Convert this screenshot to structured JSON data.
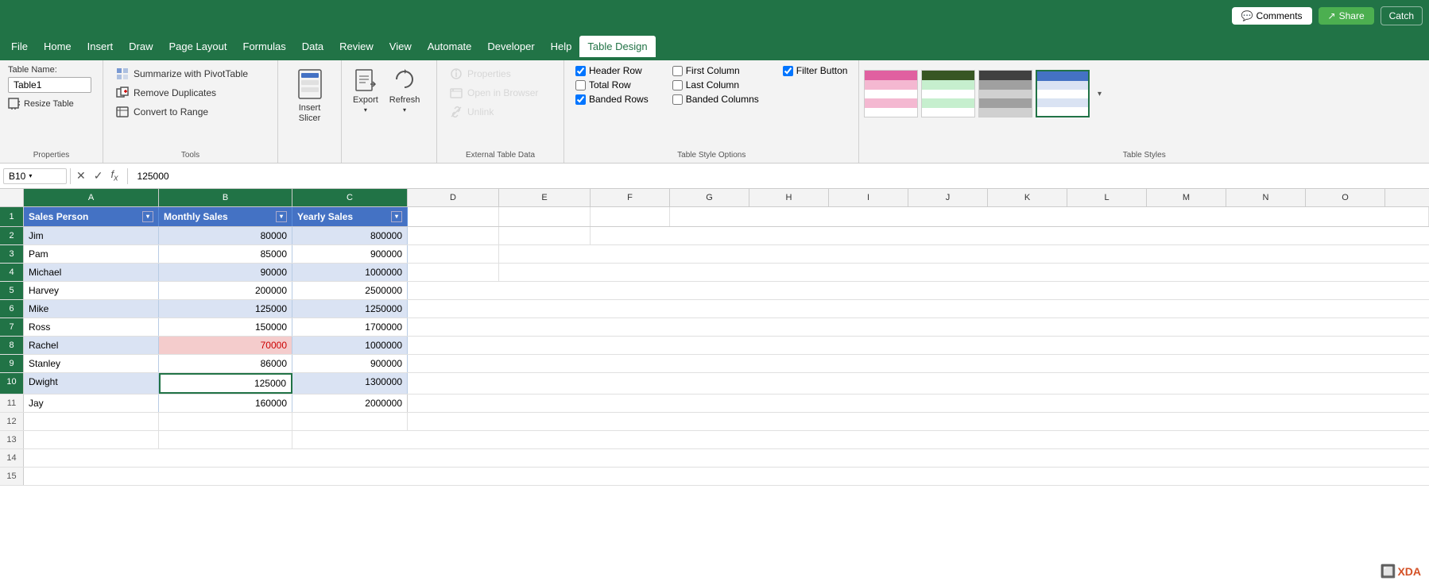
{
  "titlebar": {
    "comments_label": "Comments",
    "share_label": "Share",
    "catch_label": "Catch"
  },
  "menubar": {
    "items": [
      {
        "label": "File",
        "active": false
      },
      {
        "label": "Home",
        "active": false
      },
      {
        "label": "Insert",
        "active": false
      },
      {
        "label": "Draw",
        "active": false
      },
      {
        "label": "Page Layout",
        "active": false
      },
      {
        "label": "Formulas",
        "active": false
      },
      {
        "label": "Data",
        "active": false
      },
      {
        "label": "Review",
        "active": false
      },
      {
        "label": "View",
        "active": false
      },
      {
        "label": "Automate",
        "active": false
      },
      {
        "label": "Developer",
        "active": false
      },
      {
        "label": "Help",
        "active": false
      },
      {
        "label": "Table Design",
        "active": true
      }
    ]
  },
  "ribbon": {
    "properties": {
      "label": "Properties",
      "table_name_label": "Table Name:",
      "table_name_value": "Table1",
      "resize_label": "Resize Table"
    },
    "tools": {
      "label": "Tools",
      "summarize_label": "Summarize with PivotTable",
      "remove_duplicates_label": "Remove Duplicates",
      "convert_label": "Convert to Range"
    },
    "insert_slicer": {
      "label": "Insert\nSlicer"
    },
    "export": {
      "label": "Export",
      "refresh_label": "Refresh"
    },
    "external_table_data": {
      "label": "External Table Data",
      "properties_label": "Properties",
      "open_browser_label": "Open in Browser",
      "unlink_label": "Unlink"
    },
    "table_style_options": {
      "label": "Table Style Options",
      "header_row_label": "Header Row",
      "header_row_checked": true,
      "total_row_label": "Total Row",
      "total_row_checked": false,
      "banded_rows_label": "Banded Rows",
      "banded_rows_checked": true,
      "first_column_label": "First Column",
      "first_column_checked": false,
      "last_column_label": "Last Column",
      "last_column_checked": false,
      "banded_columns_label": "Banded Columns",
      "banded_columns_checked": false,
      "filter_button_label": "Filter Button",
      "filter_button_checked": true
    },
    "table_styles": {
      "label": "Table Styles"
    }
  },
  "formula_bar": {
    "cell_ref": "B10",
    "formula_value": "125000"
  },
  "columns": [
    "",
    "A",
    "B",
    "C",
    "D",
    "E",
    "F",
    "G",
    "H",
    "I",
    "J",
    "K",
    "L",
    "M",
    "N",
    "O"
  ],
  "table_headers": {
    "col_a": "Sales Person",
    "col_b": "Monthly Sales",
    "col_c": "Yearly Sales"
  },
  "rows": [
    {
      "row_num": "1",
      "is_header": true
    },
    {
      "row_num": "2",
      "col_a": "Jim",
      "col_b": "80000",
      "col_c": "800000",
      "odd": true
    },
    {
      "row_num": "3",
      "col_a": "Pam",
      "col_b": "85000",
      "col_c": "900000",
      "odd": false
    },
    {
      "row_num": "4",
      "col_a": "Michael",
      "col_b": "90000",
      "col_c": "1000000",
      "odd": true
    },
    {
      "row_num": "5",
      "col_a": "Harvey",
      "col_b": "200000",
      "col_c": "2500000",
      "odd": false
    },
    {
      "row_num": "6",
      "col_a": "Mike",
      "col_b": "125000",
      "col_c": "1250000",
      "odd": true
    },
    {
      "row_num": "7",
      "col_a": "Ross",
      "col_b": "150000",
      "col_c": "1700000",
      "odd": false
    },
    {
      "row_num": "8",
      "col_a": "Rachel",
      "col_b": "70000",
      "col_c": "1000000",
      "odd": true,
      "highlight_b": true
    },
    {
      "row_num": "9",
      "col_a": "Stanley",
      "col_b": "86000",
      "col_c": "900000",
      "odd": false
    },
    {
      "row_num": "10",
      "col_a": "Dwight",
      "col_b": "125000",
      "col_c": "1300000",
      "odd": true,
      "selected_b": true
    },
    {
      "row_num": "11",
      "col_a": "Jay",
      "col_b": "160000",
      "col_c": "2000000",
      "odd": false
    },
    {
      "row_num": "12",
      "col_a": "",
      "col_b": "",
      "col_c": "",
      "odd": true
    },
    {
      "row_num": "13",
      "col_a": "",
      "col_b": "",
      "col_c": "",
      "odd": false
    },
    {
      "row_num": "14",
      "col_a": "",
      "col_b": "",
      "col_c": "",
      "odd": true
    },
    {
      "row_num": "15",
      "col_a": "",
      "col_b": "",
      "col_c": "",
      "odd": false
    }
  ]
}
